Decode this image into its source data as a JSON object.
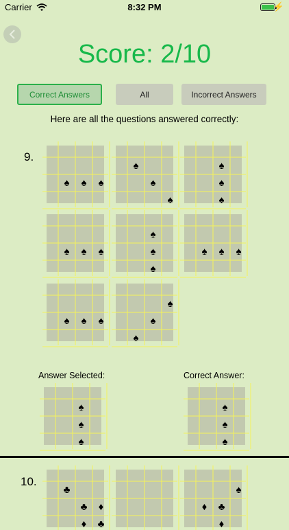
{
  "status": {
    "carrier": "Carrier",
    "time": "8:32 PM"
  },
  "score": {
    "text": "Score: 2/10"
  },
  "filters": [
    {
      "label": "Correct Answers",
      "active": true
    },
    {
      "label": "All",
      "active": false
    },
    {
      "label": "Incorrect Answers",
      "active": false
    }
  ],
  "caption": "Here are all the questions answered correctly:",
  "questions": [
    {
      "number": "9.",
      "cards": [
        {
          "suit": "♠",
          "cells": [
            [
              1,
              2
            ],
            [
              2,
              2
            ],
            [
              3,
              2
            ]
          ]
        },
        {
          "suit": "♠",
          "cells": [
            [
              1,
              1
            ],
            [
              2,
              2
            ],
            [
              3,
              3
            ]
          ]
        },
        {
          "suit": "♠",
          "cells": [
            [
              2,
              1
            ],
            [
              2,
              2
            ],
            [
              2,
              3
            ]
          ]
        },
        {
          "suit": "♠",
          "cells": [
            [
              1,
              2
            ],
            [
              2,
              2
            ],
            [
              3,
              2
            ]
          ]
        },
        {
          "suit": "♠",
          "cells": [
            [
              2,
              1
            ],
            [
              2,
              2
            ],
            [
              2,
              3
            ]
          ]
        },
        {
          "suit": "♠",
          "cells": [
            [
              1,
              2
            ],
            [
              2,
              2
            ],
            [
              3,
              2
            ]
          ]
        },
        {
          "suit": "♠",
          "cells": [
            [
              1,
              2
            ],
            [
              2,
              2
            ],
            [
              3,
              2
            ]
          ]
        },
        {
          "suit": "♠",
          "cells": [
            [
              3,
              1
            ],
            [
              2,
              2
            ],
            [
              1,
              3
            ]
          ]
        }
      ],
      "answer_selected": {
        "label": "Answer Selected:",
        "suit": "♠",
        "cells": [
          [
            2,
            1
          ],
          [
            2,
            2
          ],
          [
            2,
            3
          ]
        ]
      },
      "correct_answer": {
        "label": "Correct Answer:",
        "suit": "♠",
        "cells": [
          [
            2,
            1
          ],
          [
            2,
            2
          ],
          [
            2,
            3
          ]
        ]
      }
    },
    {
      "number": "10.",
      "cards": [
        {
          "suits": [
            "♣",
            "♣",
            "♦",
            "♦",
            "♣"
          ],
          "cells": [
            [
              1,
              1
            ],
            [
              2,
              2
            ],
            [
              3,
              2
            ],
            [
              2,
              3
            ],
            [
              3,
              3
            ]
          ]
        },
        {
          "suits": [],
          "cells": []
        },
        {
          "suits": [
            "♠",
            "♦",
            "♣",
            "♦"
          ],
          "cells": [
            [
              3,
              1
            ],
            [
              1,
              2
            ],
            [
              2,
              2
            ],
            [
              2,
              3
            ]
          ]
        }
      ]
    }
  ]
}
